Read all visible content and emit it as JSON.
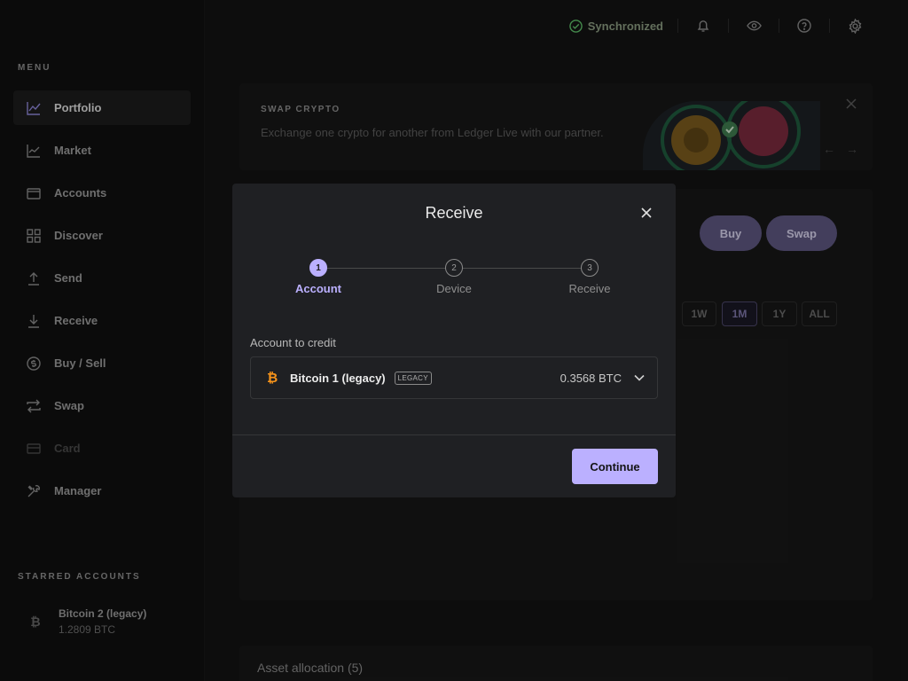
{
  "sidebar": {
    "menu_title": "MENU",
    "items": [
      {
        "label": "Portfolio",
        "icon": "chart-line-icon"
      },
      {
        "label": "Market",
        "icon": "market-chart-icon"
      },
      {
        "label": "Accounts",
        "icon": "wallet-icon"
      },
      {
        "label": "Discover",
        "icon": "apps-grid-icon"
      },
      {
        "label": "Send",
        "icon": "arrow-up-icon"
      },
      {
        "label": "Receive",
        "icon": "arrow-down-icon"
      },
      {
        "label": "Buy / Sell",
        "icon": "dollar-circle-icon"
      },
      {
        "label": "Swap",
        "icon": "swap-arrows-icon"
      },
      {
        "label": "Card",
        "icon": "card-icon"
      },
      {
        "label": "Manager",
        "icon": "tools-icon"
      }
    ],
    "starred_title": "STARRED ACCOUNTS",
    "starred": [
      {
        "name": "Bitcoin 2 (legacy)",
        "amount": "1.2809 BTC",
        "icon": "bitcoin-icon"
      }
    ]
  },
  "topbar": {
    "sync_label": "Synchronized",
    "icons": [
      "bell-icon",
      "eye-icon",
      "help-icon",
      "settings-icon"
    ]
  },
  "banner": {
    "title": "SWAP CRYPTO",
    "description": "Exchange one crypto for another from Ledger Live with our partner."
  },
  "actions": {
    "buy": "Buy",
    "swap": "Swap"
  },
  "ranges": {
    "w": "1W",
    "m": "1M",
    "y": "1Y",
    "all": "ALL",
    "selected": "1M"
  },
  "asset_allocation": "Asset allocation (5)",
  "modal": {
    "title": "Receive",
    "steps": [
      {
        "num": "1",
        "label": "Account"
      },
      {
        "num": "2",
        "label": "Device"
      },
      {
        "num": "3",
        "label": "Receive"
      }
    ],
    "active_step": 1,
    "field_label": "Account to credit",
    "account": {
      "name": "Bitcoin 1 (legacy)",
      "tag": "LEGACY",
      "balance": "0.3568 BTC",
      "icon_glyph": "₿"
    },
    "continue_label": "Continue"
  },
  "colors": {
    "accent": "#bbb0ff",
    "bitcoin": "#f7931a",
    "synced": "#5fbf6a"
  }
}
